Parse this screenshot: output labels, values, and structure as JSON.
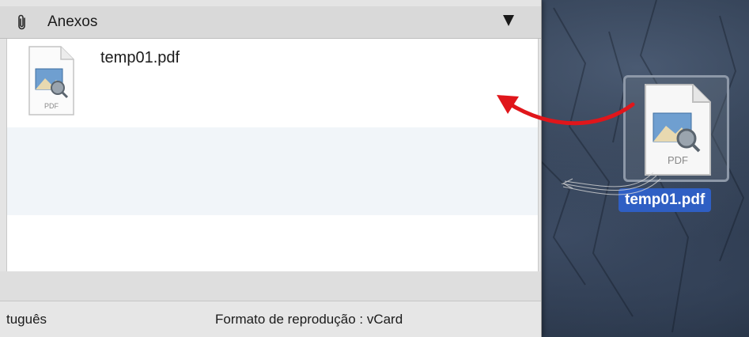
{
  "attachments_panel": {
    "title": "Anexos",
    "items": [
      {
        "name": "temp01.pdf",
        "icon": "pdf-file-icon",
        "icon_caption": "PDF"
      }
    ]
  },
  "status_bar": {
    "language": "tuguês",
    "playback_format": "Formato de reprodução : vCard"
  },
  "desktop": {
    "dragged_file": {
      "name": "temp01.pdf",
      "icon": "pdf-file-icon",
      "icon_caption": "PDF"
    }
  },
  "colors": {
    "arrow": "#e0161b",
    "selection": "#2f5fc4"
  }
}
